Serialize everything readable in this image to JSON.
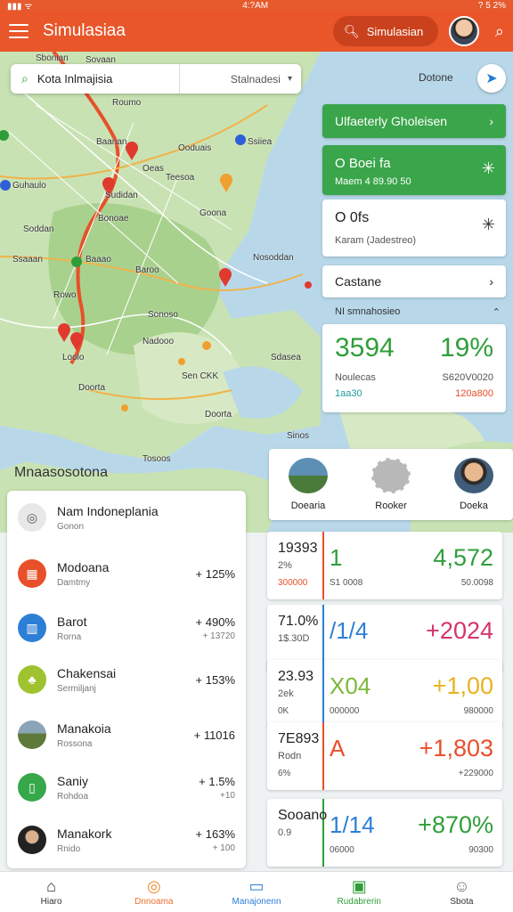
{
  "status_bar": {
    "time": "4:?AM",
    "battery": "? 5 2%"
  },
  "app_bar": {
    "title": "Simulasiaa",
    "search_label": "Simulasian"
  },
  "location_search": {
    "value": "Kota Inlmajisia",
    "select_label": "Stalnadesi"
  },
  "map": {
    "toggle_label": "Dotone",
    "labels": [
      "Sbonian",
      "Roumo",
      "Baanan",
      "Ssiiea",
      "Ooduais",
      "Oeas",
      "Guhaulo",
      "Teesoa",
      "Sudidan",
      "Goona",
      "Bonoae",
      "Soddan",
      "Baaao",
      "Nosoddan",
      "Ssaaan",
      "Baroo",
      "Rowo",
      "Sonoso",
      "Nadooo",
      "Sen CKK",
      "Sdasea",
      "Loolo",
      "Doorta",
      "Doorta",
      "Sinos",
      "Tosoos",
      "Sovaan"
    ]
  },
  "right_panel": {
    "green_header": "Ulfaeterly Gholeisen",
    "green_card": {
      "title": "O Boei fa",
      "subtitle": "Maem 4 89.90 50"
    },
    "white_card": {
      "title": "O 0fs",
      "subtitle": "Karam (Jadestreo)"
    },
    "row_label": "Castane",
    "subheader": "NI smnahosieo",
    "stats": {
      "left_value": "3594",
      "right_value": "19%",
      "left_sub": "Noulecas",
      "right_sub": "S620V0020",
      "left_low": "1aa30",
      "right_low": "120a800"
    }
  },
  "people": [
    {
      "name": "Doearia"
    },
    {
      "name": "Rooker"
    },
    {
      "name": "Doeka"
    }
  ],
  "section_title": "Mnaasosotona",
  "list_items": [
    {
      "name": "Nam Indoneplania",
      "sub": "Gonon",
      "pct": "",
      "pct_sub": "",
      "color": "#e8e8e8",
      "icon": "location-target-icon"
    },
    {
      "name": "Modoana",
      "sub": "Damtmy",
      "pct": "+ 125%",
      "pct_sub": "",
      "color": "#e8502a",
      "icon": "building-icon"
    },
    {
      "name": "Barot",
      "sub": "Rorna",
      "pct": "+ 490%",
      "pct_sub": "+ 13720",
      "color": "#2d7fd6",
      "icon": "chart-icon"
    },
    {
      "name": "Chakensai",
      "sub": "Sermiljanj",
      "pct": "+ 153%",
      "pct_sub": "",
      "color": "#9ec32e",
      "icon": "tree-icon"
    },
    {
      "name": "Manakoia",
      "sub": "Rossona",
      "pct": "+ 11016",
      "pct_sub": "",
      "color": "#6d8a3a",
      "icon": "landscape-photo-icon"
    },
    {
      "name": "Saniy",
      "sub": "Rohdoa",
      "pct": "+ 1.5%",
      "pct_sub": "+10",
      "color": "#36a84a",
      "icon": "document-icon"
    },
    {
      "name": "Manakork",
      "sub": "Rnido",
      "pct": "+ 163%",
      "pct_sub": "+ 100",
      "color": "#333333",
      "icon": "person-photo-icon"
    }
  ],
  "kpis": [
    {
      "l1": "19393",
      "l2": "2%",
      "l3": "300000",
      "l3_color": "#e8502a",
      "bar": "#e8502a",
      "c": "1",
      "c_color": "#2f9e3a",
      "cs": "S1 0008",
      "r": "4,572",
      "r_color": "#2f9e3a",
      "rs": "50.0098"
    },
    {
      "l1": "71.0%",
      "l2": "1$.30D",
      "l3": "",
      "l3_color": "#555",
      "bar": "#2d7fd6",
      "c": "/1/4",
      "c_color": "#2d7fd6",
      "cs": "",
      "r": "+2024",
      "r_color": "#d6336c",
      "rs": ""
    },
    {
      "l1": "23.93",
      "l2": "2ek",
      "l3": "0K",
      "l3_color": "#555",
      "bar": "#2d7fd6",
      "c": "X04",
      "c_color": "#7cb83a",
      "cs": "000000",
      "r": "+1,00",
      "r_color": "#e9b21f",
      "rs": "980000"
    },
    {
      "l1": "7E893",
      "l2": "Rodn",
      "l3": "6%",
      "l3_color": "#555",
      "bar": "#e8502a",
      "c": "A",
      "c_color": "#e8502a",
      "cs": "",
      "r": "+1,803",
      "r_color": "#e8502a",
      "rs": "+229000"
    },
    {
      "l1": "Sooano",
      "l2": "0.9",
      "l3": "",
      "l3_color": "#555",
      "bar": "#2f9e3a",
      "c": "1/14",
      "c_color": "#2d7fd6",
      "cs": "06000",
      "r": "+870%",
      "r_color": "#2f9e3a",
      "rs": "90300"
    }
  ],
  "bottom_nav": [
    {
      "label": "Hiaro",
      "icon": "home-icon"
    },
    {
      "label": "Dnnoama",
      "icon": "compass-icon"
    },
    {
      "label": "Manajonenn",
      "icon": "briefcase-icon"
    },
    {
      "label": "Rudabrerin",
      "icon": "report-icon"
    },
    {
      "label": "Sbota",
      "icon": "profile-icon"
    }
  ]
}
